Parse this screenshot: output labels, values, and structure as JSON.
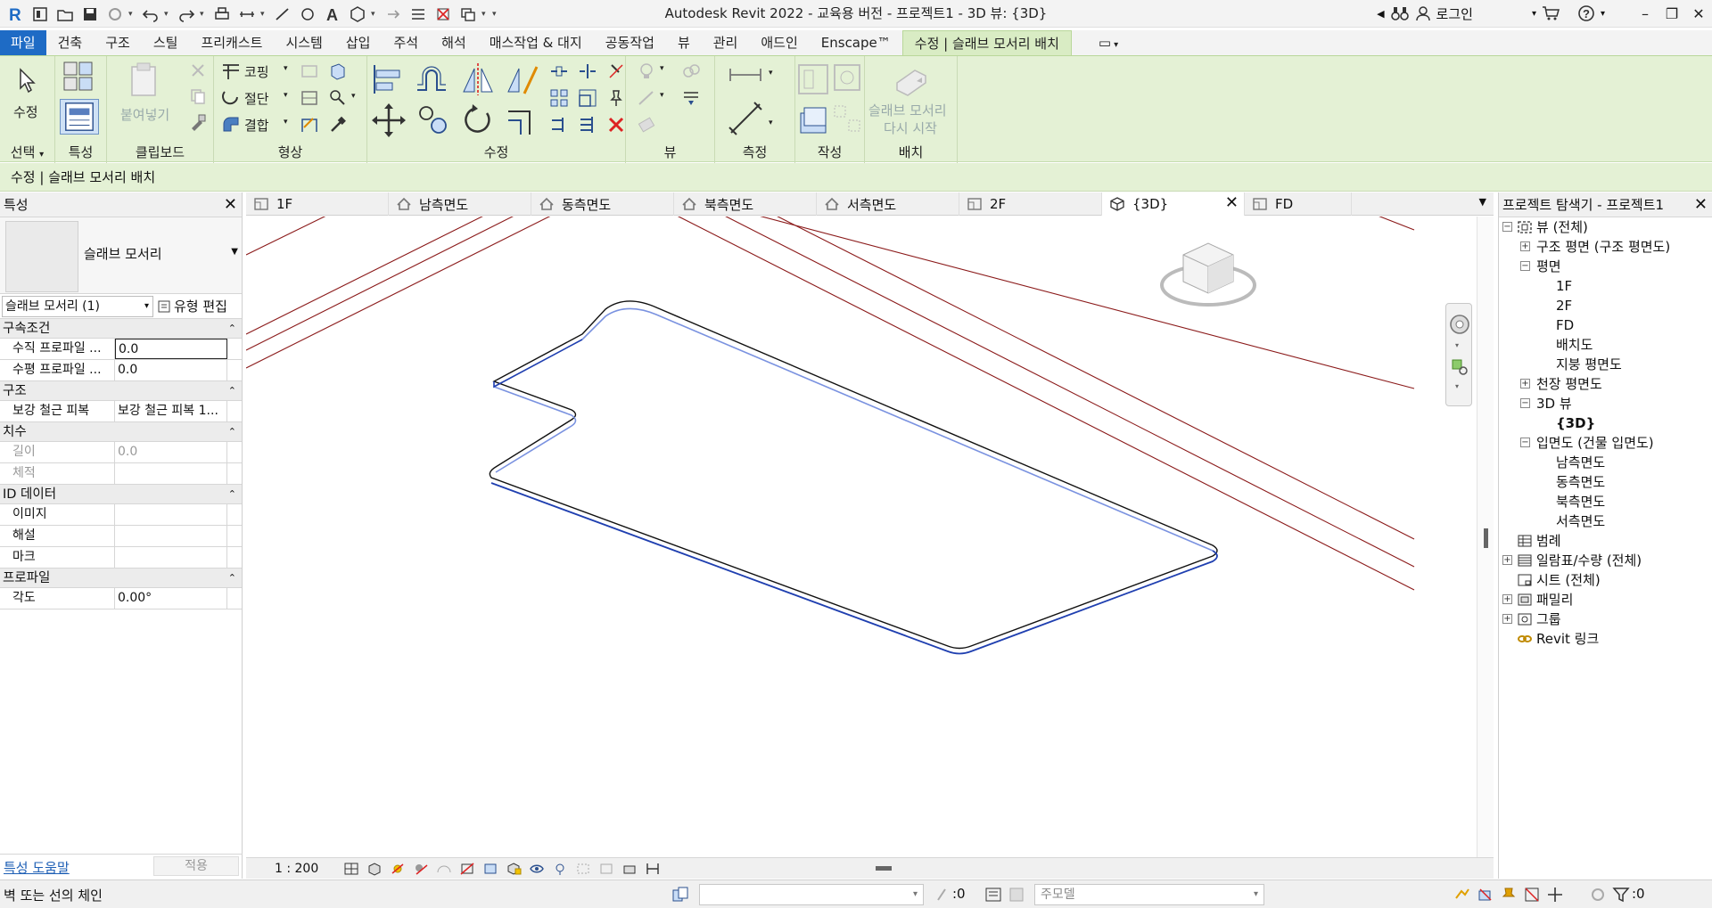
{
  "app": {
    "title": "Autodesk Revit 2022 - 교육용 버전 - 프로젝트1 - 3D 뷰: {3D}",
    "login_label": "로그인"
  },
  "ribbon_tabs": [
    {
      "label": "파일"
    },
    {
      "label": "건축"
    },
    {
      "label": "구조"
    },
    {
      "label": "스틸"
    },
    {
      "label": "프리캐스트"
    },
    {
      "label": "시스템"
    },
    {
      "label": "삽입"
    },
    {
      "label": "주석"
    },
    {
      "label": "해석"
    },
    {
      "label": "매스작업 & 대지"
    },
    {
      "label": "공동작업"
    },
    {
      "label": "뷰"
    },
    {
      "label": "관리"
    },
    {
      "label": "애드인"
    },
    {
      "label": "Enscape™"
    },
    {
      "label": "수정 | 슬래브 모서리 배치"
    }
  ],
  "ribbon": {
    "select_label": "선택",
    "modify_label": "수정",
    "properties_label": "특성",
    "clipboard_label": "클립보드",
    "paste_label": "붙여넣기",
    "geometry_label": "형상",
    "cope_label": "코핑",
    "cut_label": "절단",
    "join_label": "결합",
    "modify_panel_label": "수정",
    "view_label": "뷰",
    "measure_label": "측정",
    "create_label": "작성",
    "placement_label": "배치",
    "restart_line1": "슬래브 모서리",
    "restart_line2": "다시 시작"
  },
  "option_bar": {
    "context": "수정 | 슬래브 모서리 배치"
  },
  "properties": {
    "title": "특성",
    "type_name": "슬래브 모서리",
    "instance_selector": "슬래브 모서리 (1)",
    "edit_type": "유형 편집",
    "groups": [
      {
        "name": "구속조건",
        "rows": [
          {
            "key": "수직 프로파일 ...",
            "value": "0.0",
            "boxed": true
          },
          {
            "key": "수평 프로파일 ...",
            "value": "0.0"
          }
        ]
      },
      {
        "name": "구조",
        "rows": [
          {
            "key": "보강 철근 피복",
            "value": "보강 철근 피복 1..."
          }
        ]
      },
      {
        "name": "치수",
        "rows": [
          {
            "key": "길이",
            "value": "0.0",
            "dim": true
          },
          {
            "key": "체적",
            "value": "",
            "dim": true
          }
        ]
      },
      {
        "name": "ID 데이터",
        "rows": [
          {
            "key": "이미지",
            "value": ""
          },
          {
            "key": "해설",
            "value": ""
          },
          {
            "key": "마크",
            "value": ""
          }
        ]
      },
      {
        "name": "프로파일",
        "rows": [
          {
            "key": "각도",
            "value": "0.00°"
          }
        ]
      }
    ],
    "help_link": "특성 도움말",
    "apply_button": "적용"
  },
  "view_tabs": [
    {
      "label": "1F",
      "icon": "plan-view-icon"
    },
    {
      "label": "남측면도",
      "icon": "elevation-icon"
    },
    {
      "label": "동측면도",
      "icon": "elevation-icon"
    },
    {
      "label": "북측면도",
      "icon": "elevation-icon"
    },
    {
      "label": "서측면도",
      "icon": "elevation-icon"
    },
    {
      "label": "2F",
      "icon": "plan-view-icon"
    },
    {
      "label": "{3D}",
      "icon": "3d-view-icon",
      "active": true
    },
    {
      "label": "FD",
      "icon": "plan-view-icon"
    }
  ],
  "view_bar": {
    "scale": "1 : 200"
  },
  "browser": {
    "title": "프로젝트 탐색기 - 프로젝트1",
    "items": [
      {
        "label": "뷰 (전체)",
        "level": 0,
        "exp": "−",
        "icon": "views-icon"
      },
      {
        "label": "구조 평면 (구조 평면도)",
        "level": 1,
        "exp": "+"
      },
      {
        "label": "평면",
        "level": 1,
        "exp": "−"
      },
      {
        "label": "1F",
        "level": 2
      },
      {
        "label": "2F",
        "level": 2
      },
      {
        "label": "FD",
        "level": 2
      },
      {
        "label": "배치도",
        "level": 2
      },
      {
        "label": "지붕 평면도",
        "level": 2
      },
      {
        "label": "천장 평면도",
        "level": 1,
        "exp": "+"
      },
      {
        "label": "3D 뷰",
        "level": 1,
        "exp": "−"
      },
      {
        "label": "{3D}",
        "level": 2,
        "bold": true
      },
      {
        "label": "입면도 (건물 입면도)",
        "level": 1,
        "exp": "−"
      },
      {
        "label": "남측면도",
        "level": 2
      },
      {
        "label": "동측면도",
        "level": 2
      },
      {
        "label": "북측면도",
        "level": 2
      },
      {
        "label": "서측면도",
        "level": 2
      },
      {
        "label": "범례",
        "level": 0,
        "icon": "legend-icon"
      },
      {
        "label": "일람표/수량 (전체)",
        "level": 0,
        "exp": "+",
        "icon": "schedule-icon"
      },
      {
        "label": "시트 (전체)",
        "level": 0,
        "icon": "sheet-icon"
      },
      {
        "label": "패밀리",
        "level": 0,
        "exp": "+",
        "icon": "family-icon"
      },
      {
        "label": "그룹",
        "level": 0,
        "exp": "+",
        "icon": "group-icon"
      },
      {
        "label": "Revit 링크",
        "level": 0,
        "icon": "link-icon"
      }
    ]
  },
  "status": {
    "message": "벽 또는 선의 체인",
    "zero_a": ":0",
    "main_model": "주모델",
    "filter_count": ":0"
  },
  "colors": {
    "ribbon_bg": "#e4f1d5",
    "file_tab": "#1e6bc5",
    "grid_line": "#8b1a1a",
    "edge_blue": "#1f3fb0",
    "edge_light_blue": "#7a92e0"
  }
}
